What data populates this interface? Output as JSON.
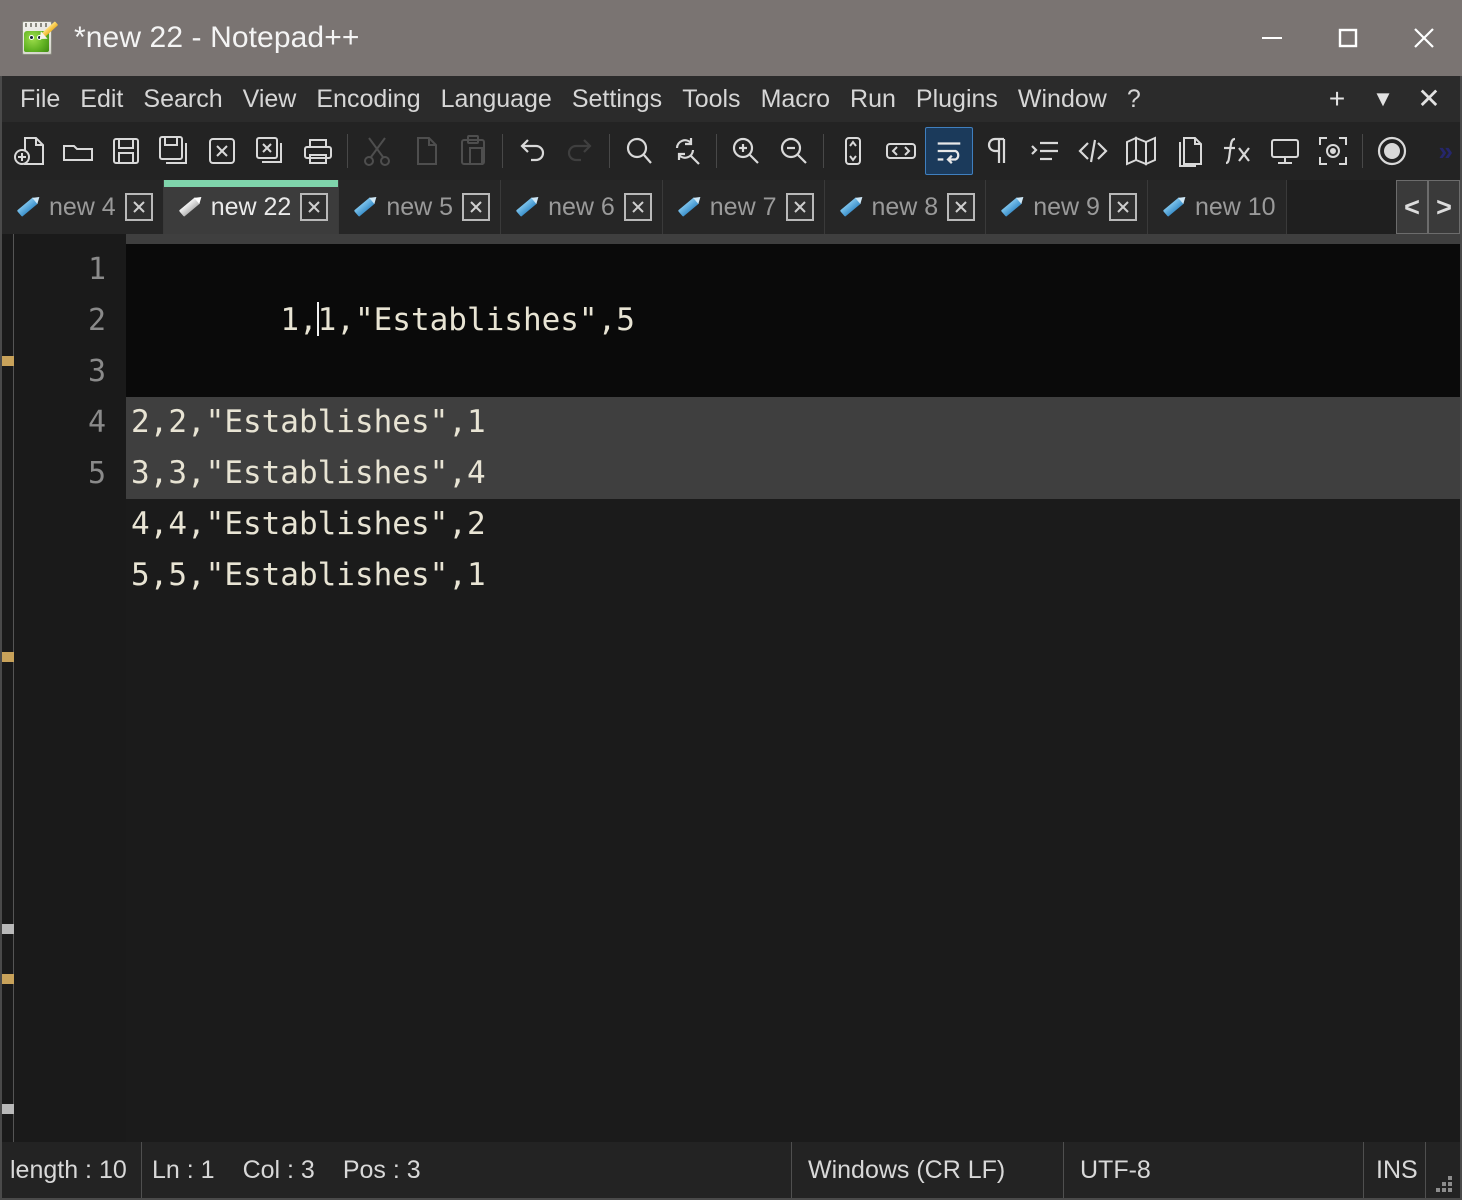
{
  "window": {
    "title": "*new 22 - Notepad++",
    "icon": "notepad-plus-plus-icon",
    "controls": {
      "minimize": "minimize-icon",
      "maximize": "maximize-icon",
      "close": "close-icon"
    }
  },
  "menubar": {
    "items": [
      {
        "label": "File"
      },
      {
        "label": "Edit"
      },
      {
        "label": "Search"
      },
      {
        "label": "View"
      },
      {
        "label": "Encoding"
      },
      {
        "label": "Language"
      },
      {
        "label": "Settings"
      },
      {
        "label": "Tools"
      },
      {
        "label": "Macro"
      },
      {
        "label": "Run"
      },
      {
        "label": "Plugins"
      },
      {
        "label": "Window"
      },
      {
        "label": "?"
      }
    ],
    "right": [
      {
        "label": "+",
        "name": "add-tab-button"
      },
      {
        "label": "▼",
        "name": "tab-list-button"
      },
      {
        "label": "✕",
        "name": "close-document-button"
      }
    ]
  },
  "toolbar": {
    "overflow_label": "»",
    "buttons": [
      {
        "name": "new-file-icon",
        "state": "enabled"
      },
      {
        "name": "open-file-icon",
        "state": "enabled"
      },
      {
        "name": "save-icon",
        "state": "enabled"
      },
      {
        "name": "save-all-icon",
        "state": "enabled"
      },
      {
        "name": "close-file-icon",
        "state": "enabled"
      },
      {
        "name": "close-all-files-icon",
        "state": "enabled"
      },
      {
        "name": "print-icon",
        "state": "enabled"
      },
      {
        "name": "cut-icon",
        "state": "disabled"
      },
      {
        "name": "copy-icon",
        "state": "disabled"
      },
      {
        "name": "paste-icon",
        "state": "disabled"
      },
      {
        "name": "undo-icon",
        "state": "enabled"
      },
      {
        "name": "redo-icon",
        "state": "disabled"
      },
      {
        "name": "find-icon",
        "state": "enabled"
      },
      {
        "name": "replace-icon",
        "state": "enabled"
      },
      {
        "name": "zoom-in-icon",
        "state": "enabled"
      },
      {
        "name": "zoom-out-icon",
        "state": "enabled"
      },
      {
        "name": "sync-vertical-scrolling-icon",
        "state": "enabled"
      },
      {
        "name": "sync-horizontal-scrolling-icon",
        "state": "enabled"
      },
      {
        "name": "word-wrap-icon",
        "state": "active"
      },
      {
        "name": "show-all-characters-icon",
        "state": "enabled"
      },
      {
        "name": "indent-guide-icon",
        "state": "enabled"
      },
      {
        "name": "user-defined-language-icon",
        "state": "enabled"
      },
      {
        "name": "document-map-icon",
        "state": "enabled"
      },
      {
        "name": "document-list-icon",
        "state": "enabled"
      },
      {
        "name": "function-list-icon",
        "state": "enabled"
      },
      {
        "name": "monitoring-icon",
        "state": "enabled"
      },
      {
        "name": "distraction-free-mode-icon",
        "state": "enabled"
      },
      {
        "name": "record-macro-icon",
        "state": "enabled"
      }
    ]
  },
  "tabs": {
    "items": [
      {
        "label": "new 4",
        "active": false,
        "modified": false
      },
      {
        "label": "new 22",
        "active": true,
        "modified": true
      },
      {
        "label": "new 5",
        "active": false,
        "modified": false
      },
      {
        "label": "new 6",
        "active": false,
        "modified": false
      },
      {
        "label": "new 7",
        "active": false,
        "modified": false
      },
      {
        "label": "new 8",
        "active": false,
        "modified": false
      },
      {
        "label": "new 9",
        "active": false,
        "modified": false
      },
      {
        "label": "new 10",
        "active": false,
        "modified": false
      }
    ],
    "scroll_left": "<",
    "scroll_right": ">",
    "active_accent_color": "#7fd4ab"
  },
  "editor": {
    "line_numbers": [
      "1",
      "2",
      "3",
      "4",
      "5"
    ],
    "lines": [
      {
        "text": "1,1,\"Establishes\",5",
        "current": true,
        "caret_after_chars": 2
      },
      {
        "text": "2,2,\"Establishes\",1",
        "current": false
      },
      {
        "text": "3,3,\"Establishes\",4",
        "current": false
      },
      {
        "text": "4,4,\"Establishes\",2",
        "current": false
      },
      {
        "text": "5,5,\"Establishes\",1",
        "current": false
      }
    ],
    "text_color": "#e8e4d4",
    "background_color": "#3f3f3f",
    "current_line_color": "#0a0a0a"
  },
  "statusbar": {
    "length": "length : 10",
    "ln": "Ln : 1",
    "col": "Col : 3",
    "pos": "Pos : 3",
    "eol": "Windows (CR LF)",
    "encoding": "UTF-8",
    "insert_mode": "INS"
  }
}
